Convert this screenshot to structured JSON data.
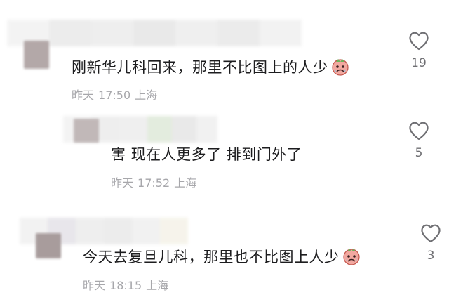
{
  "comments": [
    {
      "text": "刚新华儿科回来，那里不比图上的人少",
      "emoji": "crying-face-emoji",
      "date": "昨天",
      "time": "17:50",
      "location": "上海",
      "likes": "19"
    },
    {
      "text": "害 现在人更多了 排到门外了",
      "date": "昨天",
      "time": "17:52",
      "location": "上海",
      "likes": "5"
    },
    {
      "text": "今天去复旦儿科，那里也不比图上人少",
      "emoji": "crying-face-emoji",
      "date": "昨天",
      "time": "18:15",
      "location": "上海",
      "likes": "3"
    }
  ],
  "colors": {
    "text": "#1d1d1f",
    "meta": "#a7a7ab",
    "heart": "#6f6f73"
  }
}
